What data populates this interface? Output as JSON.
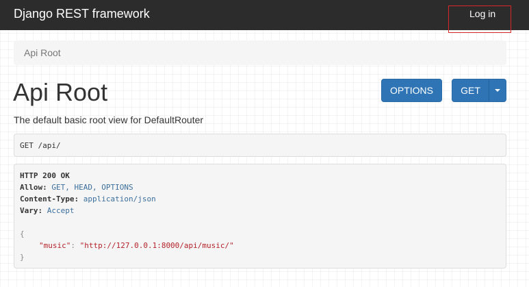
{
  "navbar": {
    "brand": "Django REST framework",
    "login_label": "Log in",
    "highlight_color": "#d9262b"
  },
  "breadcrumb": {
    "items": [
      "Api Root"
    ]
  },
  "page": {
    "title": "Api Root",
    "description": "The default basic root view for DefaultRouter"
  },
  "buttons": {
    "options_label": "OPTIONS",
    "get_label": "GET",
    "caret_icon": "caret-down-icon"
  },
  "request": {
    "method": "GET",
    "path": "/api/"
  },
  "response": {
    "status": "HTTP 200 OK",
    "headers": [
      {
        "key": "Allow",
        "value": "GET, HEAD, OPTIONS"
      },
      {
        "key": "Content-Type",
        "value": "application/json"
      },
      {
        "key": "Vary",
        "value": "Accept"
      }
    ],
    "body": {
      "open": "{",
      "entries": [
        {
          "key": "\"music\"",
          "value": "\"http://127.0.0.1:8000/api/music/\""
        }
      ],
      "close": "}"
    }
  },
  "colors": {
    "navbar_bg": "#2c2c2c",
    "button_primary": "#2f75b5",
    "header_value": "#3b6e9c",
    "json_string": "#b4232a"
  }
}
